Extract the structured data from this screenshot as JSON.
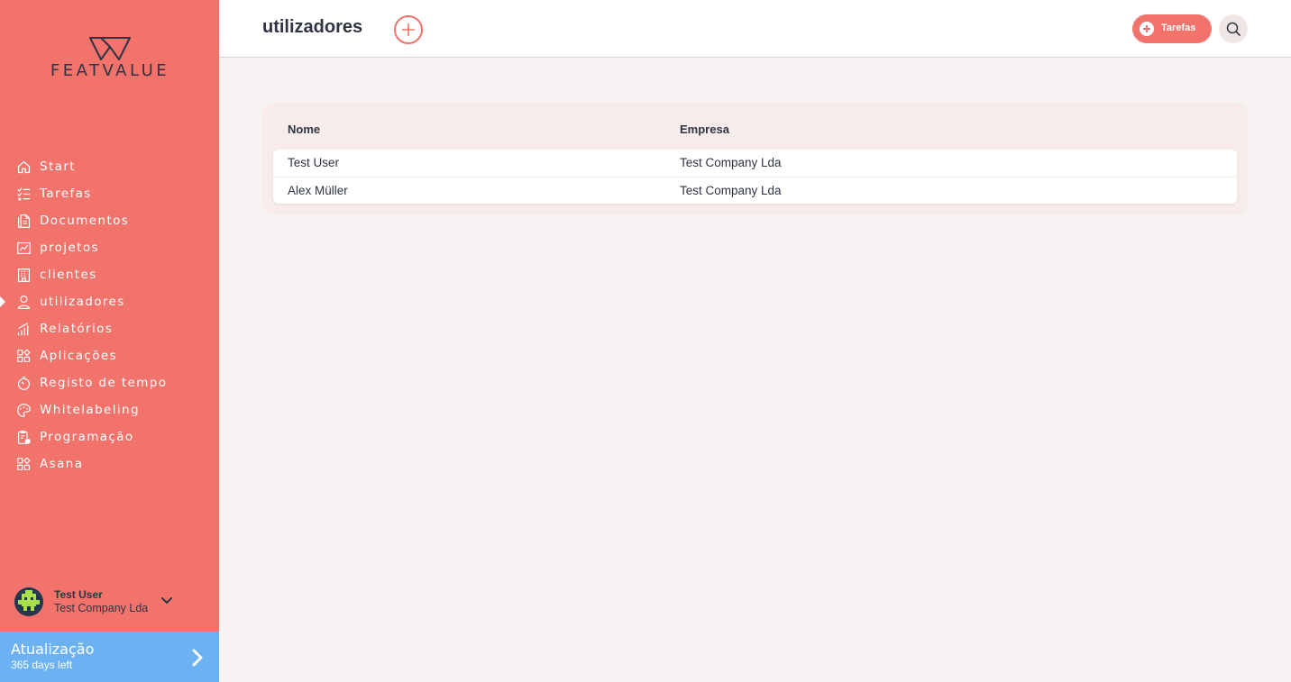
{
  "brand": {
    "name": "FEATVALUE"
  },
  "colors": {
    "sidebar": "#f2736b",
    "accent": "#f2736b",
    "update": "#6cb1f2",
    "text": "#2f3442",
    "background": "#f7f3f2"
  },
  "sidebar": {
    "items": [
      {
        "label": "Start",
        "icon": "home-icon"
      },
      {
        "label": "Tarefas",
        "icon": "task-list-icon"
      },
      {
        "label": "Documentos",
        "icon": "documents-icon"
      },
      {
        "label": "projetos",
        "icon": "chart-board-icon"
      },
      {
        "label": "clientes",
        "icon": "building-icon"
      },
      {
        "label": "utilizadores",
        "icon": "user-icon",
        "active": true
      },
      {
        "label": "Relatórios",
        "icon": "bar-chart-icon"
      },
      {
        "label": "Aplicações",
        "icon": "apps-icon"
      },
      {
        "label": "Registo de tempo",
        "icon": "timer-icon"
      },
      {
        "label": "Whitelabeling",
        "icon": "palette-icon"
      },
      {
        "label": "Programação",
        "icon": "schedule-icon"
      },
      {
        "label": "Asana",
        "icon": "apps-icon"
      }
    ],
    "user": {
      "name": "Test User",
      "company": "Test Company Lda"
    },
    "update": {
      "title": "Atualização",
      "subtitle": "365 days left"
    }
  },
  "header": {
    "title": "utilizadores",
    "tasks_label": "Tarefas"
  },
  "table": {
    "columns": [
      "Nome",
      "Empresa"
    ],
    "rows": [
      {
        "name": "Test User",
        "company": "Test Company Lda"
      },
      {
        "name": "Alex Müller",
        "company": "Test Company Lda"
      }
    ]
  }
}
